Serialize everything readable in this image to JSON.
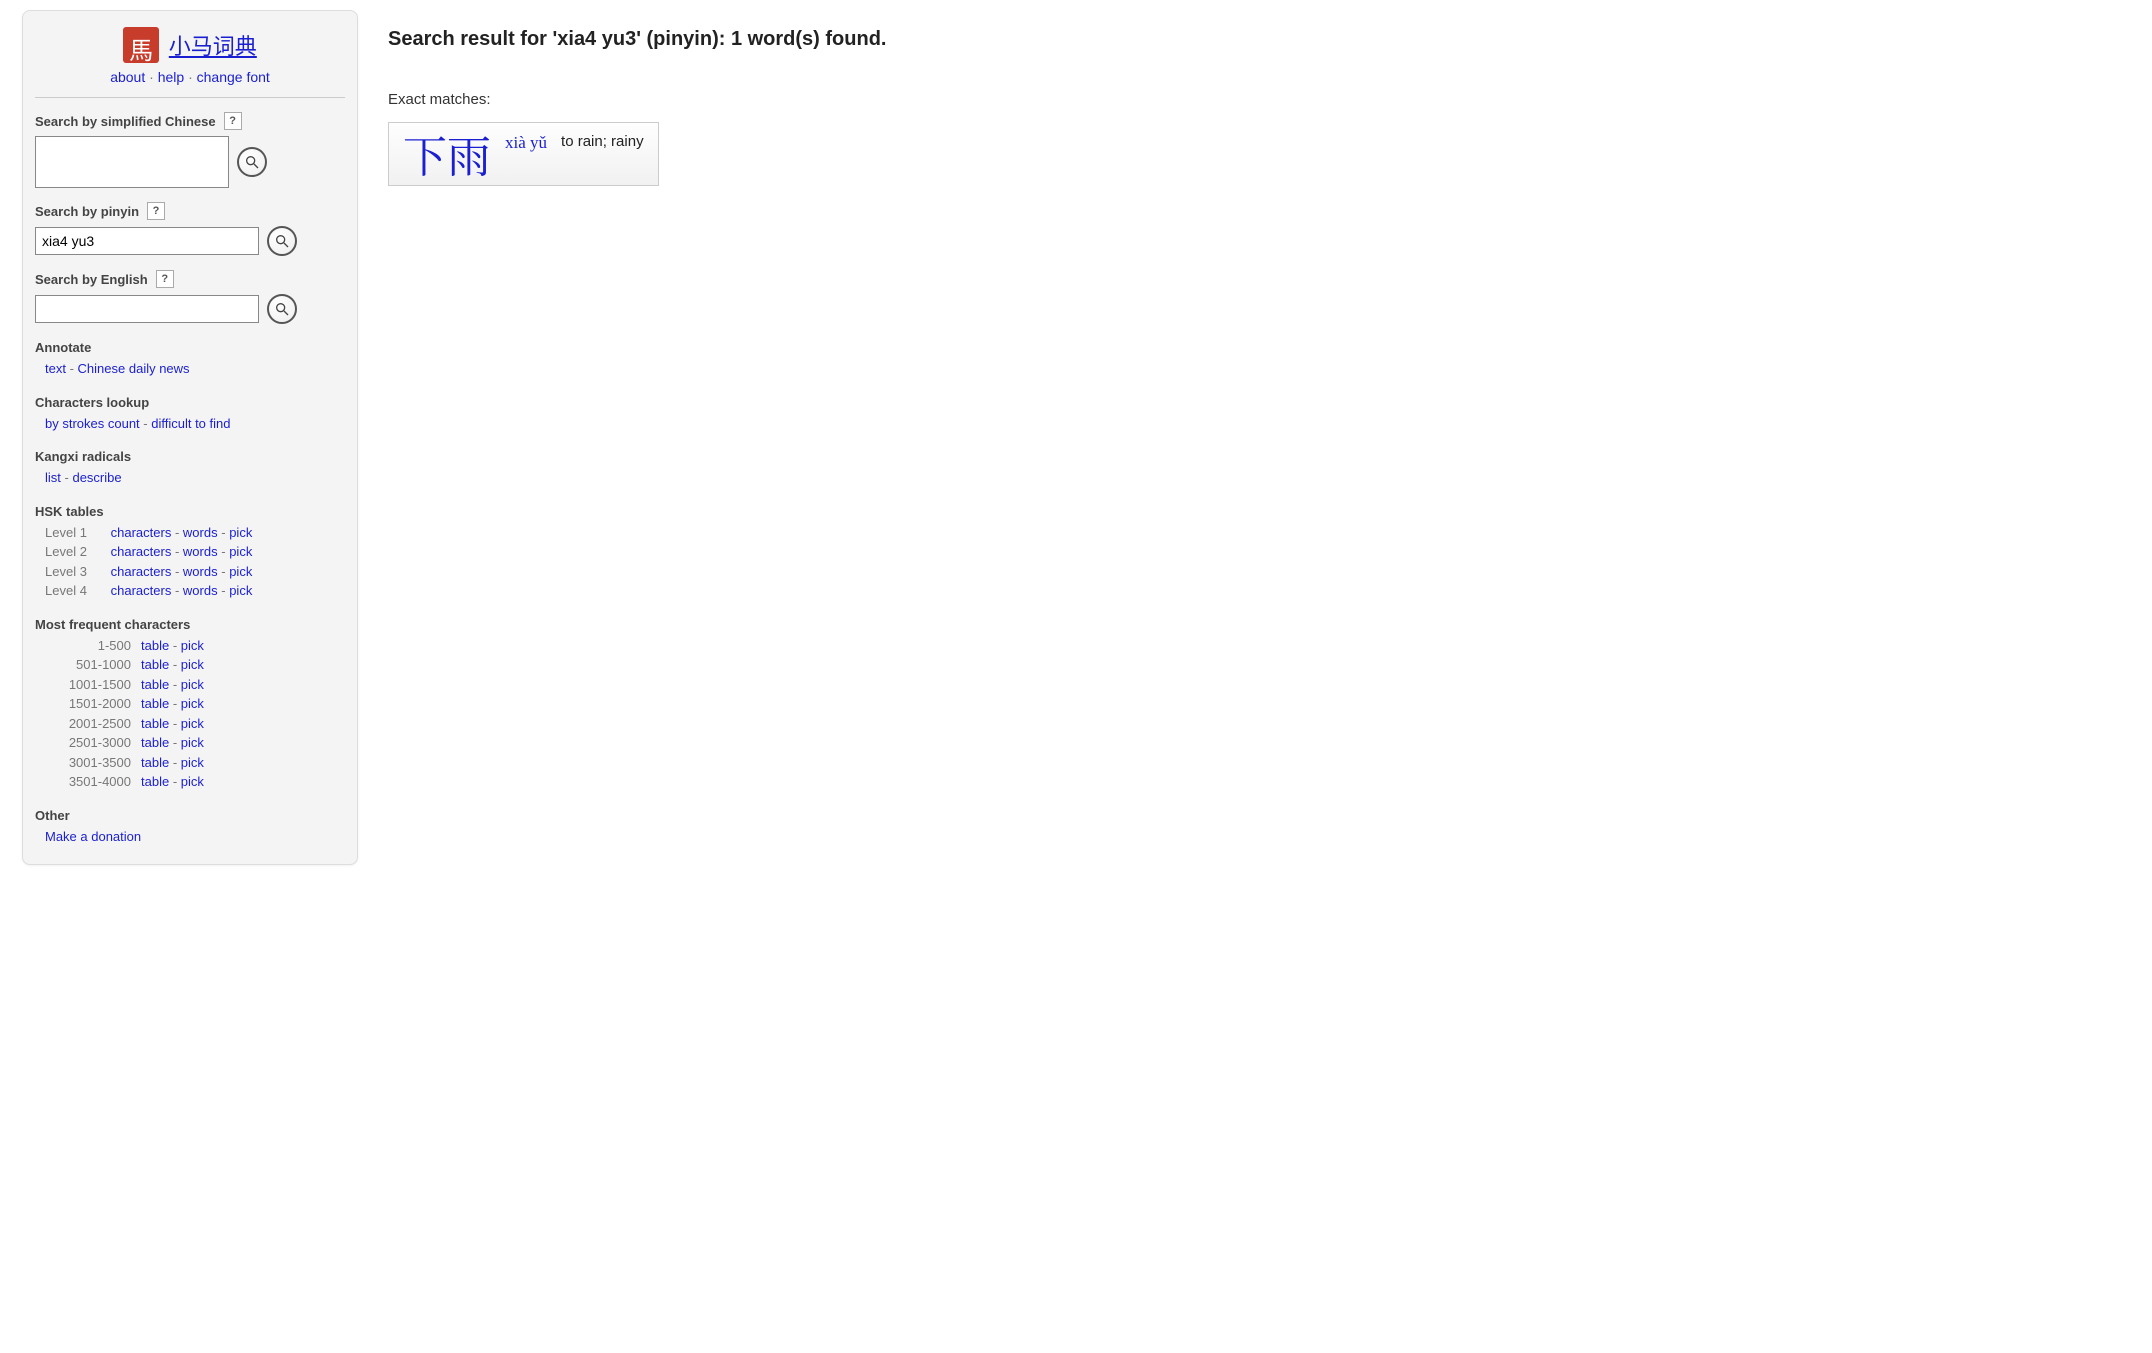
{
  "header": {
    "site_title": "小马词典",
    "subnav": {
      "about": "about",
      "help": "help",
      "change_font": "change font"
    }
  },
  "search": {
    "chinese": {
      "label": "Search by simplified Chinese",
      "help": "?",
      "value": ""
    },
    "pinyin": {
      "label": "Search by pinyin",
      "help": "?",
      "value": "xia4 yu3"
    },
    "english": {
      "label": "Search by English",
      "help": "?",
      "value": ""
    }
  },
  "annotate": {
    "title": "Annotate",
    "text_link": "text",
    "news_link": "Chinese daily news"
  },
  "charlookup": {
    "title": "Characters lookup",
    "strokes": "by strokes count",
    "difficult": "difficult to find"
  },
  "kangxi": {
    "title": "Kangxi radicals",
    "list": "list",
    "describe": "describe"
  },
  "hsk": {
    "title": "HSK tables",
    "levels": [
      {
        "label": "Level 1",
        "characters": "characters",
        "words": "words",
        "pick": "pick"
      },
      {
        "label": "Level 2",
        "characters": "characters",
        "words": "words",
        "pick": "pick"
      },
      {
        "label": "Level 3",
        "characters": "characters",
        "words": "words",
        "pick": "pick"
      },
      {
        "label": "Level 4",
        "characters": "characters",
        "words": "words",
        "pick": "pick"
      }
    ]
  },
  "freq": {
    "title": "Most frequent characters",
    "ranges": [
      {
        "label": "1-500",
        "table": "table",
        "pick": "pick"
      },
      {
        "label": "501-1000",
        "table": "table",
        "pick": "pick"
      },
      {
        "label": "1001-1500",
        "table": "table",
        "pick": "pick"
      },
      {
        "label": "1501-2000",
        "table": "table",
        "pick": "pick"
      },
      {
        "label": "2001-2500",
        "table": "table",
        "pick": "pick"
      },
      {
        "label": "2501-3000",
        "table": "table",
        "pick": "pick"
      },
      {
        "label": "3001-3500",
        "table": "table",
        "pick": "pick"
      },
      {
        "label": "3501-4000",
        "table": "table",
        "pick": "pick"
      }
    ]
  },
  "other": {
    "title": "Other",
    "donate": "Make a donation"
  },
  "main": {
    "title": "Search result for 'xia4 yu3' (pinyin): 1 word(s) found.",
    "exact_label": "Exact matches:",
    "entry": {
      "hanzi": "下雨",
      "pinyin": "xià yǔ",
      "definition": "to rain; rainy"
    }
  }
}
